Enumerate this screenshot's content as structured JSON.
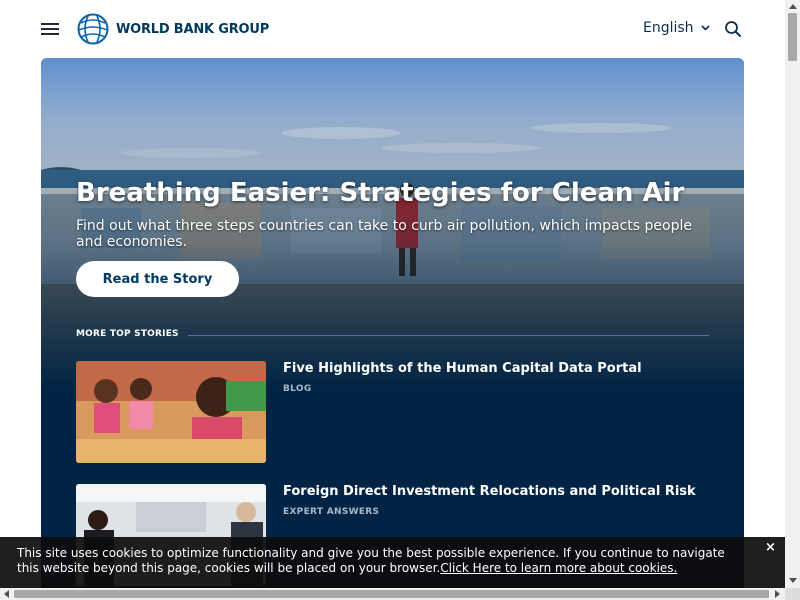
{
  "header": {
    "logo_text": "WORLD BANK GROUP",
    "language": "English",
    "icons": {
      "menu": "hamburger-menu-icon",
      "language": "chevron-down-icon",
      "search": "search-icon",
      "logo": "globe-logo-icon"
    }
  },
  "hero": {
    "title": "Breathing Easier: Strategies for Clean Air",
    "description": "Find out what three steps countries can take to curb air pollution, which impacts people and economies.",
    "button_label": "Read the Story"
  },
  "more_stories": {
    "heading": "MORE TOP STORIES",
    "items": [
      {
        "title": "Five Highlights of the Human Capital Data Portal",
        "tag": "BLOG"
      },
      {
        "title": "Foreign Direct Investment Relocations and Political Risk",
        "tag": "EXPERT ANSWERS"
      }
    ]
  },
  "cookie_banner": {
    "text": "This site uses cookies to optimize functionality and give you the best possible experience. If you continue to navigate this website beyond this page, cookies will be placed on your browser.",
    "link_text": "Click Here to learn more about cookies.",
    "close_label": "×"
  },
  "colors": {
    "brand_navy": "#00395c",
    "hero_background": "#022444",
    "button_text": "#003a66",
    "cookie_background": "#0c0c0c"
  }
}
